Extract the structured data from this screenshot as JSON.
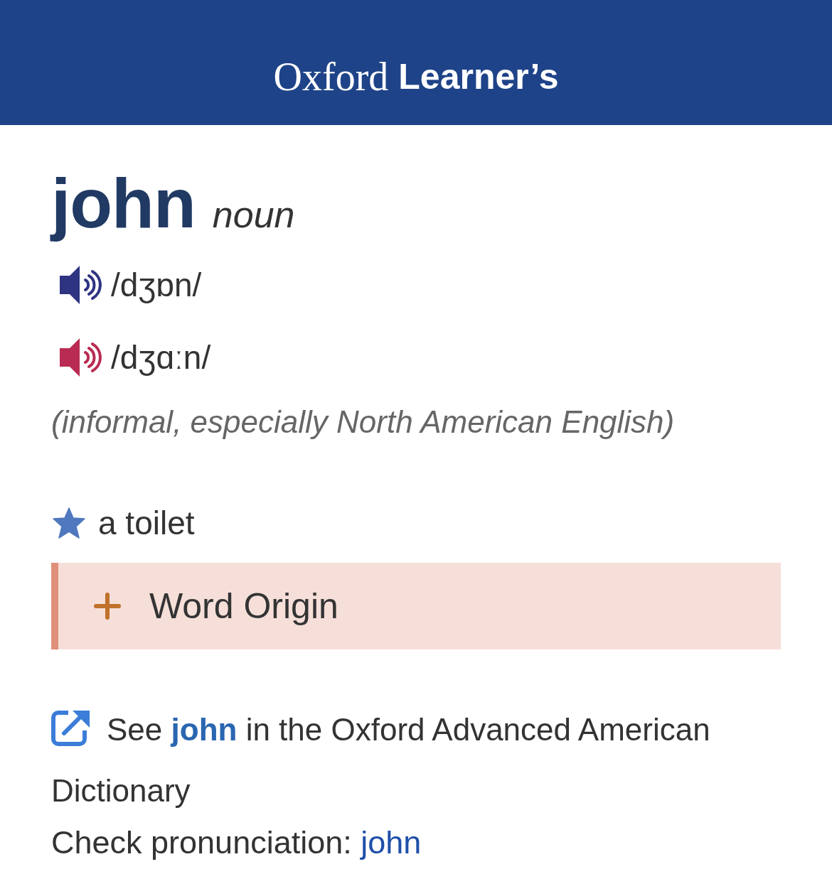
{
  "header": {
    "logo": [
      {
        "text": "Oxford",
        "kind": "serif"
      },
      {
        "text": "Learner’s",
        "kind": "sans"
      }
    ]
  },
  "entry": {
    "headword": "john",
    "part_of_speech": "noun",
    "pronunciations": [
      {
        "ipa": "/dʒɒn/",
        "color": "#2e3382"
      },
      {
        "ipa": "/dʒɑːn/",
        "color": "#b92b52"
      }
    ],
    "labels": "(informal, especially North American English)",
    "senses": [
      {
        "definition": "a toilet",
        "starred": true
      }
    ],
    "word_origin": {
      "label": "Word Origin",
      "expanded": false
    }
  },
  "see_also": {
    "before": "See",
    "link": "john",
    "after": "in the Oxford Advanced American Dictionary"
  },
  "check_pronunciation": {
    "label": "Check pronunciation:",
    "link": "john"
  }
}
